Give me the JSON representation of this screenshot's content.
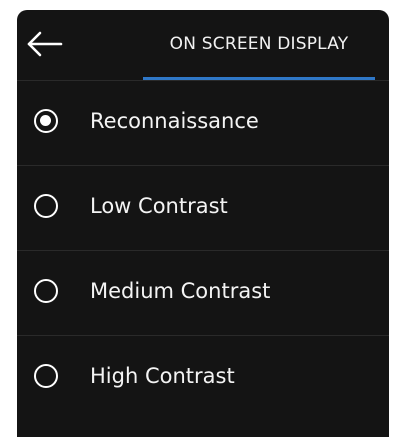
{
  "header": {
    "back_icon": "arrow-left-icon",
    "tab_label": "ON SCREEN DISPLAY",
    "accent_color": "#2f78c8"
  },
  "options": [
    {
      "label": "Reconnaissance",
      "selected": true
    },
    {
      "label": "Low Contrast",
      "selected": false
    },
    {
      "label": "Medium Contrast",
      "selected": false
    },
    {
      "label": "High Contrast",
      "selected": false
    }
  ]
}
